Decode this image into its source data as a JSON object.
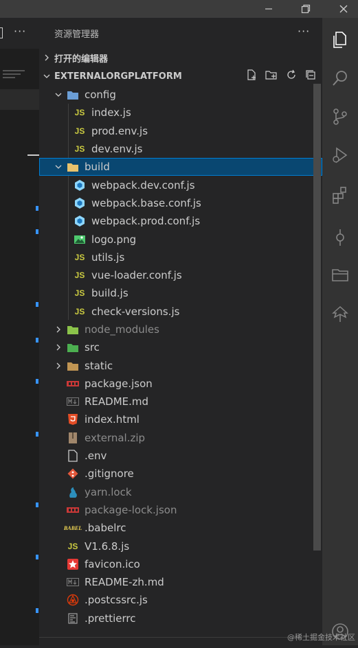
{
  "window": {
    "controls": [
      "minimize-icon",
      "restore-icon",
      "close-icon"
    ]
  },
  "editor": {
    "more_label": "···"
  },
  "explorer": {
    "title": "资源管理器",
    "more_label": "···",
    "open_editors_label": "打开的编辑器",
    "project_label": "EXTERNALORGPLATFORM",
    "header_actions": [
      "new-file-icon",
      "new-folder-icon",
      "refresh-icon",
      "collapse-all-icon"
    ],
    "items": [
      {
        "label": "config",
        "depth": 1,
        "kind": "folder-open",
        "icon": "config-folder-icon",
        "color": "#6b9ed6"
      },
      {
        "label": "index.js",
        "depth": 2,
        "kind": "file",
        "icon": "js-file-icon",
        "color": "#cbcb41"
      },
      {
        "label": "prod.env.js",
        "depth": 2,
        "kind": "file",
        "icon": "js-file-icon",
        "color": "#cbcb41"
      },
      {
        "label": "dev.env.js",
        "depth": 2,
        "kind": "file",
        "icon": "js-file-icon",
        "color": "#cbcb41"
      },
      {
        "label": "build",
        "depth": 1,
        "kind": "folder-open",
        "icon": "build-folder-icon",
        "color": "#e8c26c",
        "selected": true
      },
      {
        "label": "webpack.dev.conf.js",
        "depth": 2,
        "kind": "file",
        "icon": "webpack-icon",
        "color": "#8ed6fb"
      },
      {
        "label": "webpack.base.conf.js",
        "depth": 2,
        "kind": "file",
        "icon": "webpack-icon",
        "color": "#8ed6fb"
      },
      {
        "label": "webpack.prod.conf.js",
        "depth": 2,
        "kind": "file",
        "icon": "webpack-icon",
        "color": "#8ed6fb"
      },
      {
        "label": "logo.png",
        "depth": 2,
        "kind": "file",
        "icon": "image-file-icon",
        "color": "#4ec96e"
      },
      {
        "label": "utils.js",
        "depth": 2,
        "kind": "file",
        "icon": "js-file-icon",
        "color": "#cbcb41"
      },
      {
        "label": "vue-loader.conf.js",
        "depth": 2,
        "kind": "file",
        "icon": "js-file-icon",
        "color": "#cbcb41"
      },
      {
        "label": "build.js",
        "depth": 2,
        "kind": "file",
        "icon": "js-file-icon",
        "color": "#cbcb41"
      },
      {
        "label": "check-versions.js",
        "depth": 2,
        "kind": "file",
        "icon": "js-file-icon",
        "color": "#cbcb41"
      },
      {
        "label": "node_modules",
        "depth": 1,
        "kind": "folder",
        "icon": "node-modules-folder-icon",
        "color": "#8bc34a",
        "dim": true
      },
      {
        "label": "src",
        "depth": 1,
        "kind": "folder",
        "icon": "src-folder-icon",
        "color": "#4caf50"
      },
      {
        "label": "static",
        "depth": 1,
        "kind": "folder",
        "icon": "folder-icon",
        "color": "#c09553"
      },
      {
        "label": "package.json",
        "depth": 1,
        "kind": "file",
        "icon": "npm-file-icon",
        "color": "#cb3837"
      },
      {
        "label": "README.md",
        "depth": 1,
        "kind": "file",
        "icon": "markdown-file-icon",
        "color": "#7a7a7a"
      },
      {
        "label": "index.html",
        "depth": 1,
        "kind": "file",
        "icon": "html-file-icon",
        "color": "#e44d26"
      },
      {
        "label": "external.zip",
        "depth": 1,
        "kind": "file",
        "icon": "zip-file-icon",
        "color": "#a0866b",
        "dim": true
      },
      {
        "label": ".env",
        "depth": 1,
        "kind": "file",
        "icon": "blank-file-icon",
        "color": "#cccccc"
      },
      {
        "label": ".gitignore",
        "depth": 1,
        "kind": "file",
        "icon": "git-file-icon",
        "color": "#e2573a"
      },
      {
        "label": "yarn.lock",
        "depth": 1,
        "kind": "file",
        "icon": "yarn-file-icon",
        "color": "#2c8ebb",
        "dim": true
      },
      {
        "label": "package-lock.json",
        "depth": 1,
        "kind": "file",
        "icon": "npm-file-icon",
        "color": "#cb3837",
        "dim": true
      },
      {
        "label": ".babelrc",
        "depth": 1,
        "kind": "file",
        "icon": "babel-file-icon",
        "color": "#f5da55"
      },
      {
        "label": "V1.6.8.js",
        "depth": 1,
        "kind": "file",
        "icon": "js-file-icon",
        "color": "#cbcb41"
      },
      {
        "label": "favicon.ico",
        "depth": 1,
        "kind": "file",
        "icon": "favicon-file-icon",
        "color": "#e53935"
      },
      {
        "label": "README-zh.md",
        "depth": 1,
        "kind": "file",
        "icon": "markdown-file-icon",
        "color": "#7a7a7a"
      },
      {
        "label": ".postcssrc.js",
        "depth": 1,
        "kind": "file",
        "icon": "postcss-file-icon",
        "color": "#dd3a0a"
      },
      {
        "label": ".prettierrc",
        "depth": 1,
        "kind": "file",
        "icon": "prettier-file-icon",
        "color": "#a0a0a0"
      }
    ]
  },
  "activity_bar": [
    "explorer-icon",
    "search-icon",
    "source-control-icon",
    "run-debug-icon",
    "extensions-icon",
    "git-graph-icon",
    "remote-explorer-icon",
    "gitlens-icon",
    "account-icon"
  ],
  "watermark": "@稀土掘金技术社区"
}
